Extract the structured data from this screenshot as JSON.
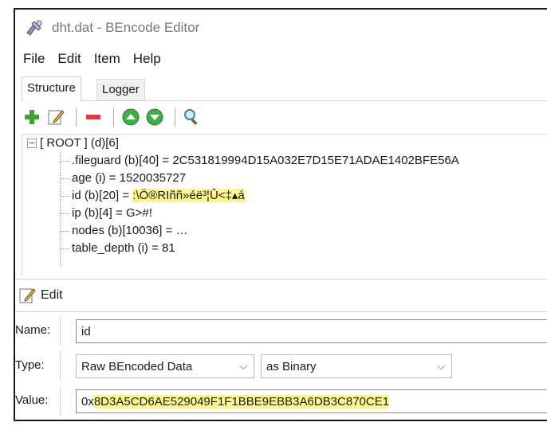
{
  "window": {
    "title": "dht.dat - BEncode Editor"
  },
  "menu": [
    "File",
    "Edit",
    "Item",
    "Help"
  ],
  "tabs": [
    "Structure",
    "Logger"
  ],
  "toolbar": {
    "icons": [
      "add-icon",
      "edit-icon",
      "remove-icon",
      "move-up-icon",
      "move-down-icon",
      "search-icon"
    ]
  },
  "tree": {
    "root": "[ ROOT ] (d)[6]",
    "items": [
      {
        "text": ".fileguard (b)[40] = 2C531819994D15A032E7D15E71ADAE1402BFE56A"
      },
      {
        "text": "age (i) = 1520035727"
      },
      {
        "prefix": "id (b)[20] = ",
        "highlight": ":\\Ö®RIññ»éë³¦Û<‡▴á"
      },
      {
        "text": "ip (b)[4] = G>#!"
      },
      {
        "text": "nodes (b)[10036] = …"
      },
      {
        "text": "table_depth (i) = 81"
      }
    ]
  },
  "edit": {
    "title": "Edit",
    "name_label": "Name:",
    "name_value": "id",
    "type_label": "Type:",
    "type_value": "Raw BEncoded Data",
    "format_value": "as Binary",
    "value_label": "Value:",
    "value_prefix": "0x",
    "value_hex": "8D3A5CD6AE529049F1F1BBE9EBB3A6DB3C870CE1"
  },
  "colors": {
    "highlight": "#fff68a",
    "add_green": "#3aa52b",
    "remove_red": "#e23a3a",
    "arrow_green": "#3fae49"
  }
}
